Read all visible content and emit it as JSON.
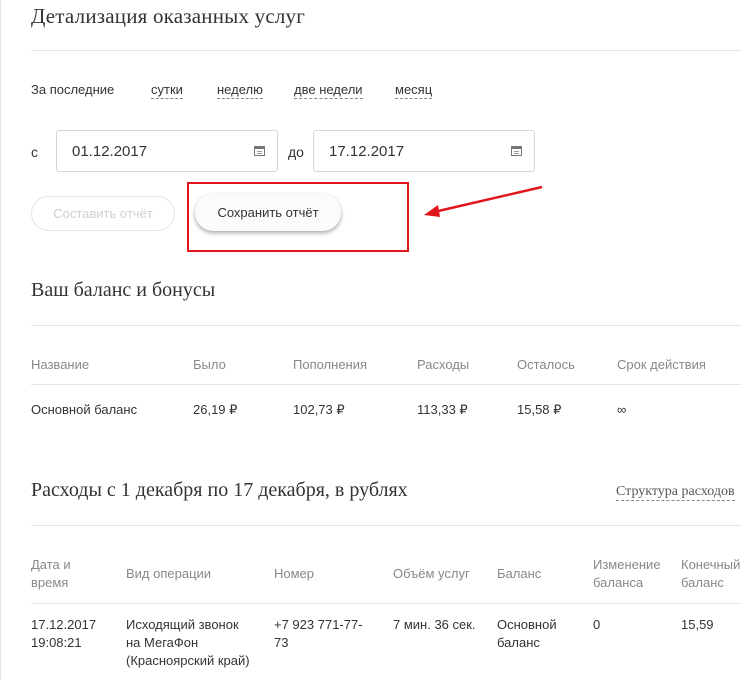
{
  "page": {
    "title": "Детализация оказанных услуг",
    "period": {
      "label": "За последние",
      "options": [
        "сутки",
        "неделю",
        "две недели",
        "месяц"
      ]
    },
    "date_range": {
      "from_label": "с",
      "from_value": "01.12.2017",
      "to_label": "до",
      "to_value": "17.12.2017"
    },
    "buttons": {
      "compose": "Составить отчёт",
      "save": "Сохранить отчёт"
    },
    "annotation": {
      "highlight_color": "#e0161b"
    }
  },
  "balance": {
    "title": "Ваш баланс и бонусы",
    "headers": [
      "Название",
      "Было",
      "Пополнения",
      "Расходы",
      "Осталось",
      "Срок действия"
    ],
    "row": [
      "Основной баланс",
      "26,19 ₽",
      "102,73 ₽",
      "113,33 ₽",
      "15,58 ₽",
      "∞"
    ]
  },
  "expenses": {
    "title": "Расходы с 1 декабря по 17 декабря, в рублях",
    "structure_link": "Структура расходов",
    "headers": {
      "datetime": [
        "Дата и",
        "время"
      ],
      "operation": "Вид операции",
      "number": "Номер",
      "volume": "Объём услуг",
      "balance": "Баланс",
      "change": [
        "Изменение",
        "баланса"
      ],
      "final": [
        "Конечный",
        "баланс"
      ]
    },
    "row": {
      "date": "17.12.2017",
      "time": "19:08:21",
      "operation": [
        "Исходящий звонок",
        "на МегаФон",
        "(Красноярский край)"
      ],
      "number": [
        "+7 923 771-77-",
        "73"
      ],
      "volume": "7 мин. 36 сек.",
      "balance": [
        "Основной",
        "баланс"
      ],
      "change": "0",
      "final": "15,59"
    }
  }
}
